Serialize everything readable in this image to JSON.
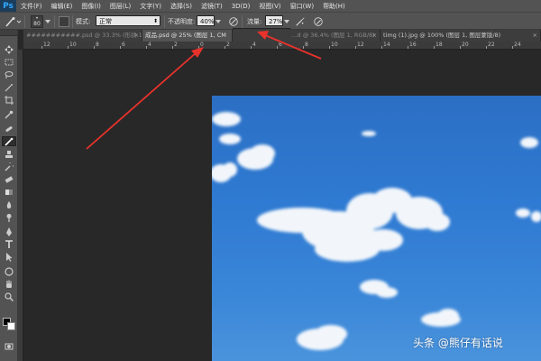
{
  "app": {
    "logo": "Ps"
  },
  "menu": [
    "文件(F)",
    "编辑(E)",
    "图像(I)",
    "图层(L)",
    "文字(Y)",
    "选择(S)",
    "滤镜(T)",
    "3D(D)",
    "视图(V)",
    "窗口(W)",
    "帮助(H)"
  ],
  "options": {
    "brush_size": "80",
    "mode_label": "模式:",
    "mode_value": "正常",
    "opacity_label": "不透明度:",
    "opacity_value": "40%",
    "flow_label": "流量:",
    "flow_value": "27%",
    "flow_slider_fraction": 0.27
  },
  "tabs": [
    {
      "label": "###########.psd @ 33.3% (形状 14, CMYK/8)",
      "active": false
    },
    {
      "label": "成品.psd @ 25% (图层 1, CM",
      "active": true
    },
    {
      "label": "…d @ 36.4% (图层 1, RGB/8)",
      "active": false
    },
    {
      "label": "timg (1).jpg @ 100% (图层 1, 图层蒙版/8)",
      "active": false
    }
  ],
  "ruler_top_labels": [
    "12",
    "10",
    "8",
    "6",
    "4",
    "2",
    "0",
    "2",
    "4",
    "6",
    "8",
    "10",
    "12",
    "14",
    "16",
    "18",
    "20",
    "22",
    "24"
  ],
  "watermark": "头条 @熊仔有话说",
  "colors": {
    "chrome": "#535353",
    "canvas_bg": "#282828",
    "arrow": "#e8322c",
    "sky": "#2f7ad2"
  },
  "tools": [
    "move-icon",
    "marquee-icon",
    "lasso-icon",
    "magic-wand-icon",
    "crop-icon",
    "eyedropper-icon",
    "healing-icon",
    "brush-icon",
    "clone-stamp-icon",
    "history-brush-icon",
    "eraser-icon",
    "gradient-icon",
    "blur-icon",
    "dodge-icon",
    "pen-icon",
    "type-icon",
    "path-select-icon",
    "shape-icon",
    "hand-icon",
    "zoom-icon"
  ]
}
